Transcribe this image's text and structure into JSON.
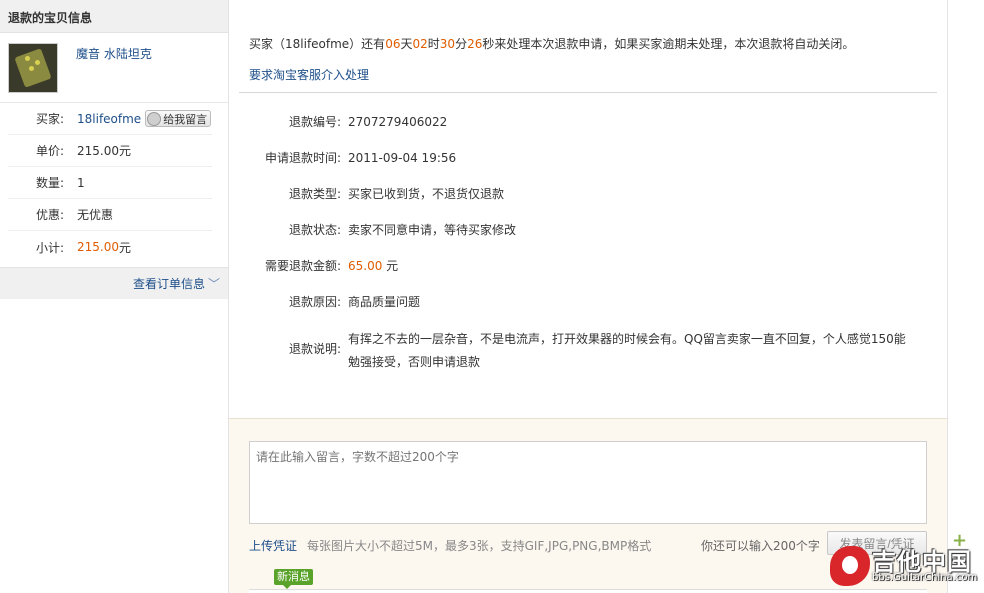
{
  "sidebar": {
    "title": "退款的宝贝信息",
    "product_name": "魔音 水陆坦克",
    "rows": [
      {
        "label": "买家:",
        "value": "18lifeofme"
      },
      {
        "label": "单价:",
        "value": "215.00元"
      },
      {
        "label": "数量:",
        "value": "1"
      },
      {
        "label": "优惠:",
        "value": "无优惠"
      },
      {
        "label": "小计:",
        "value_num": "215.00",
        "value_unit": "元"
      }
    ],
    "message_button": "给我留言",
    "view_order": "查看订单信息"
  },
  "notice": {
    "p1": "买家（18lifeofme）还有",
    "days": "06",
    "t_days": "天",
    "hours": "02",
    "t_hours": "时",
    "minutes": "30",
    "t_minutes": "分",
    "seconds": "26",
    "p2": "秒来处理本次退款申请，如果买家逾期未处理，本次退款将自动关闭。",
    "escalate": "要求淘宝客服介入处理"
  },
  "details": {
    "refund_no_label": "退款编号:",
    "refund_no": "2707279406022",
    "apply_time_label": "申请退款时间:",
    "apply_time": "2011-09-04 19:56",
    "type_label": "退款类型:",
    "type": "买家已收到货，不退货仅退款",
    "status_label": "退款状态:",
    "status": "卖家不同意申请，等待买家修改",
    "amount_label": "需要退款金额:",
    "amount": "65.00",
    "amount_unit": " 元",
    "reason_label": "退款原因:",
    "reason": "商品质量问题",
    "desc_label": "退款说明:",
    "desc": "有挥之不去的一层杂音，不是电流声，打开效果器的时候会有。QQ留言卖家一直不回复，个人感觉150能勉强接受，否则申请退款"
  },
  "message": {
    "placeholder": "请在此输入留言，字数不超过200个字",
    "upload": "上传凭证",
    "upload_hint": "每张图片大小不超过5M，最多3张，支持GIF,JPG,PNG,BMP格式",
    "remaining": "你还可以输入200个字",
    "send": "发表留言/凭证",
    "new_badge": "新消息"
  },
  "watermark": {
    "name": "吉他中国",
    "url": "bbs.GuitarChina.com"
  },
  "colors": {
    "link": "#1e4f8a",
    "highlight": "#e05c00",
    "badge": "#5aa32a"
  }
}
